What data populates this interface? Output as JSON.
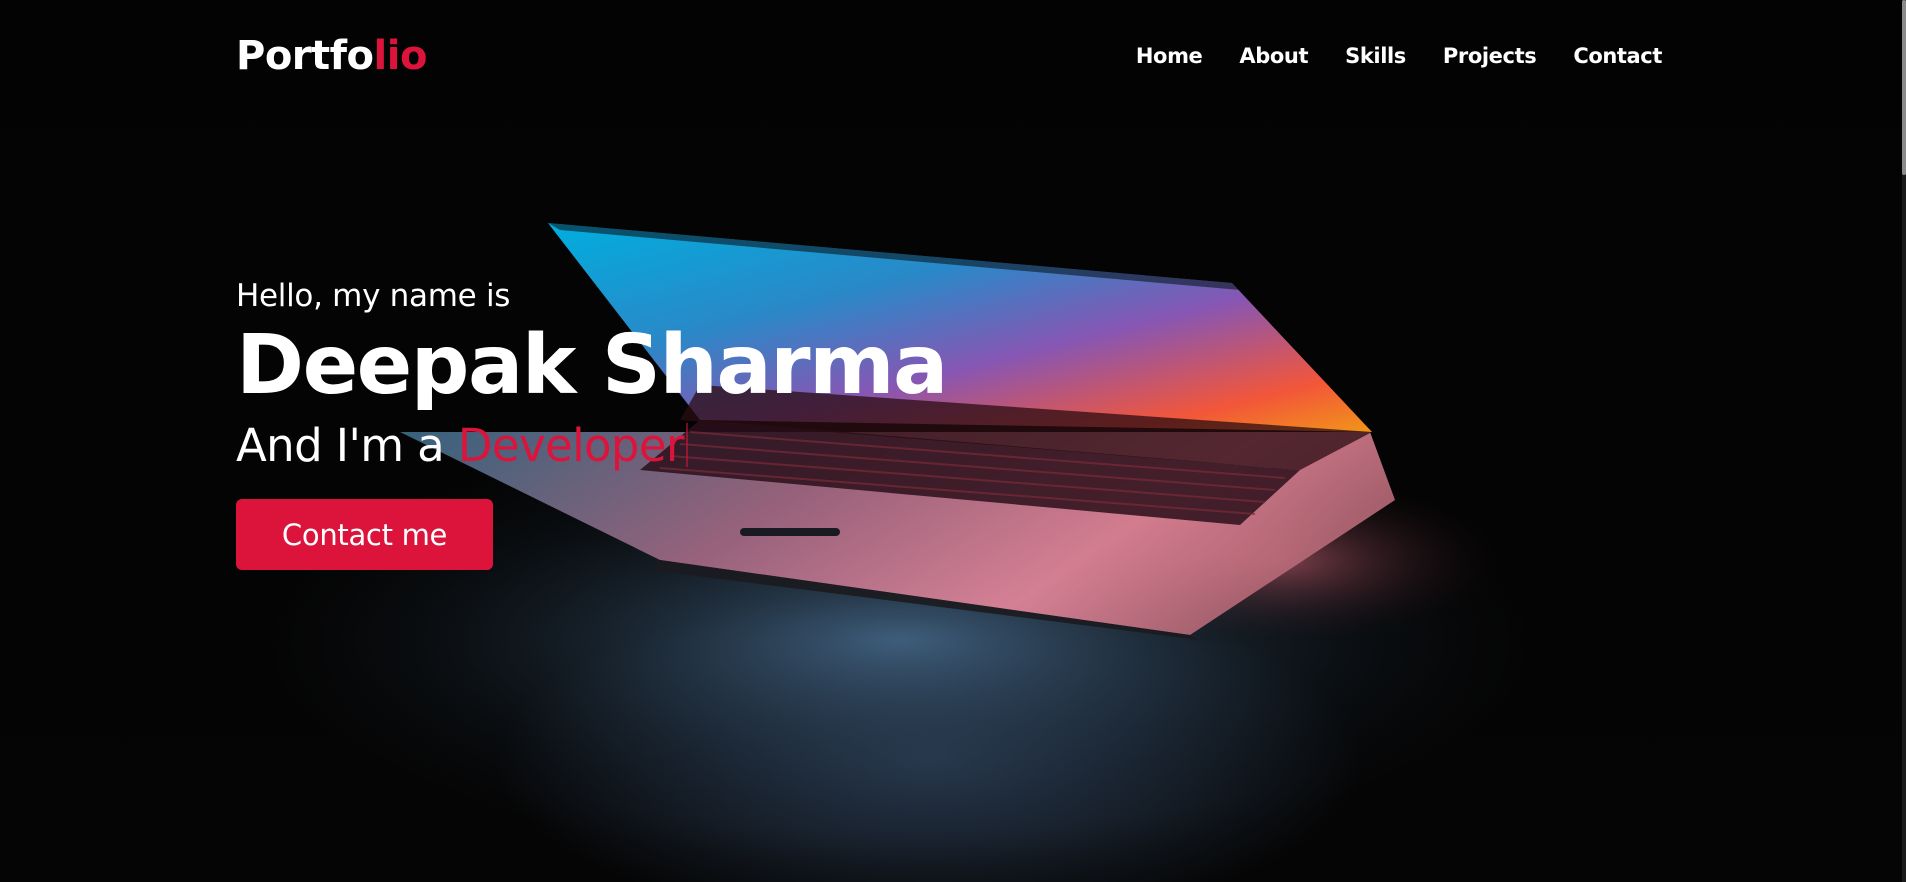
{
  "logo": {
    "main": "Portfo",
    "accent": "lio"
  },
  "nav": {
    "items": [
      {
        "label": "Home"
      },
      {
        "label": "About"
      },
      {
        "label": "Skills"
      },
      {
        "label": "Projects"
      },
      {
        "label": "Contact"
      }
    ]
  },
  "hero": {
    "greeting": "Hello, my name is",
    "name": "Deepak Sharma",
    "tagline_prefix": "And I'm a ",
    "role": "Developer",
    "cta_label": "Contact me"
  },
  "colors": {
    "accent": "#dc143c",
    "background": "#030303",
    "text": "#ffffff"
  }
}
